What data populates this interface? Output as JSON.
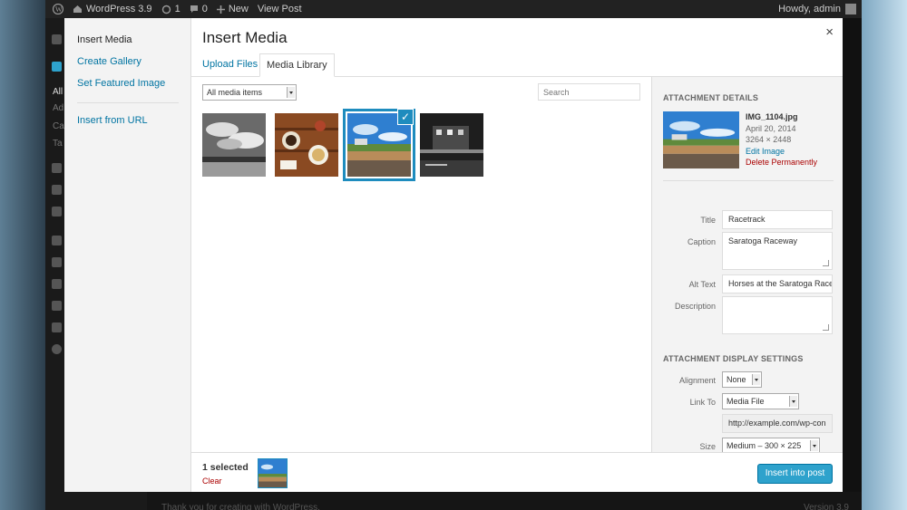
{
  "admin_bar": {
    "site_name": "WordPress 3.9",
    "updates_count": "1",
    "comments_count": "0",
    "new_label": "New",
    "view_post_label": "View Post",
    "howdy": "Howdy, admin"
  },
  "admin_footer": {
    "thanks": "Thank you for creating with WordPress.",
    "version": "Version 3.9"
  },
  "media_menu": {
    "items": [
      {
        "label": "Insert Media"
      },
      {
        "label": "Create Gallery"
      },
      {
        "label": "Set Featured Image"
      },
      {
        "label": "Insert from URL"
      }
    ]
  },
  "modal": {
    "title": "Insert Media",
    "close_glyph": "×"
  },
  "tabs": [
    {
      "label": "Upload Files"
    },
    {
      "label": "Media Library"
    }
  ],
  "filter": {
    "selected": "All media items"
  },
  "search": {
    "placeholder": "Search"
  },
  "attachment_details": {
    "heading": "ATTACHMENT DETAILS",
    "filename": "IMG_1104.jpg",
    "date": "April 20, 2014",
    "dimensions": "3264 × 2448",
    "edit_link": "Edit Image",
    "delete_link": "Delete Permanently",
    "fields": {
      "title_label": "Title",
      "title_value": "Racetrack",
      "caption_label": "Caption",
      "caption_value": "Saratoga Raceway",
      "alt_label": "Alt Text",
      "alt_value": "Horses at the Saratoga Race",
      "description_label": "Description",
      "description_value": ""
    }
  },
  "display_settings": {
    "heading": "ATTACHMENT DISPLAY SETTINGS",
    "alignment_label": "Alignment",
    "alignment_value": "None",
    "link_to_label": "Link To",
    "link_to_value": "Media File",
    "url_value": "http://example.com/wp-con",
    "size_label": "Size",
    "size_value": "Medium – 300 × 225"
  },
  "toolbar": {
    "selected_count": "1 selected",
    "clear_label": "Clear",
    "insert_label": "Insert into post"
  },
  "colors": {
    "accent": "#2ea2cc",
    "link": "#0074a2",
    "selection_border": "#1e8cbe",
    "danger": "#aa0000"
  }
}
